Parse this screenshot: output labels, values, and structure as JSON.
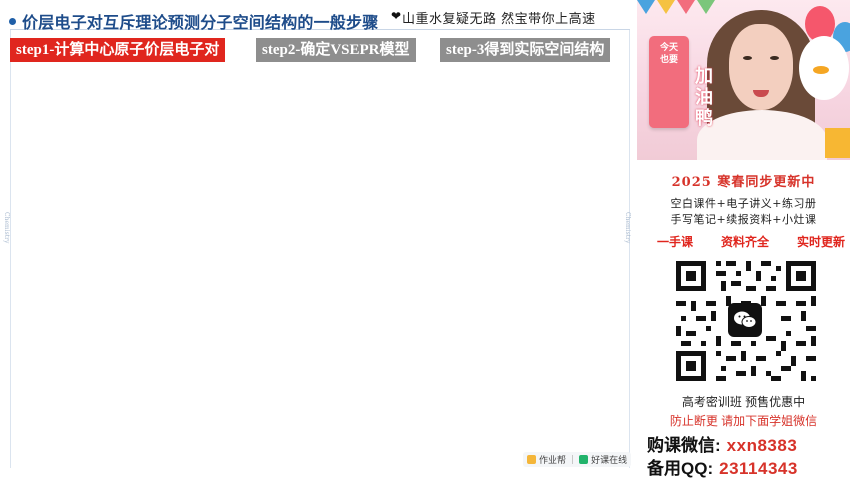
{
  "slide": {
    "title": "价层电子对互斥理论预测分子空间结构的一般步骤",
    "slogan": "山重水复疑无路 然宝带你上高速",
    "side_word": "Chemistry",
    "steps": [
      {
        "label": "step1-计算中心原子价层电子对",
        "color": "#e0261e"
      },
      {
        "label": "step2-确定VSEPR模型",
        "color": "#8e8e8e"
      },
      {
        "label": "step-3得到实际空间结构",
        "color": "#8e8e8e"
      }
    ],
    "footer": {
      "brand1": "作业帮",
      "brand2": "好课在线"
    }
  },
  "video": {
    "sign_small": [
      "今天",
      "也要"
    ],
    "sign_big": [
      "加",
      "油",
      "鸭"
    ]
  },
  "promo": {
    "year_line": "2025  寒春同步更新中",
    "features": [
      "空白课件+电子讲义+练习册",
      "手写笔记+续报资料+小灶课"
    ],
    "tags": [
      "一手课",
      "资料齐全",
      "实时更新"
    ],
    "qr_icon": "wechat-icon",
    "class_line": "高考密训班  预售优惠中",
    "warn_line": "防止断更 请加下面学姐微信",
    "contacts": [
      {
        "key": "购课微信:",
        "value": "xxn8383"
      },
      {
        "key": "备用QQ:",
        "value": "23114343"
      }
    ]
  },
  "colors": {
    "accent_red": "#e0261e",
    "title_blue": "#1e4c8a",
    "step_gray": "#8e8e8e"
  }
}
